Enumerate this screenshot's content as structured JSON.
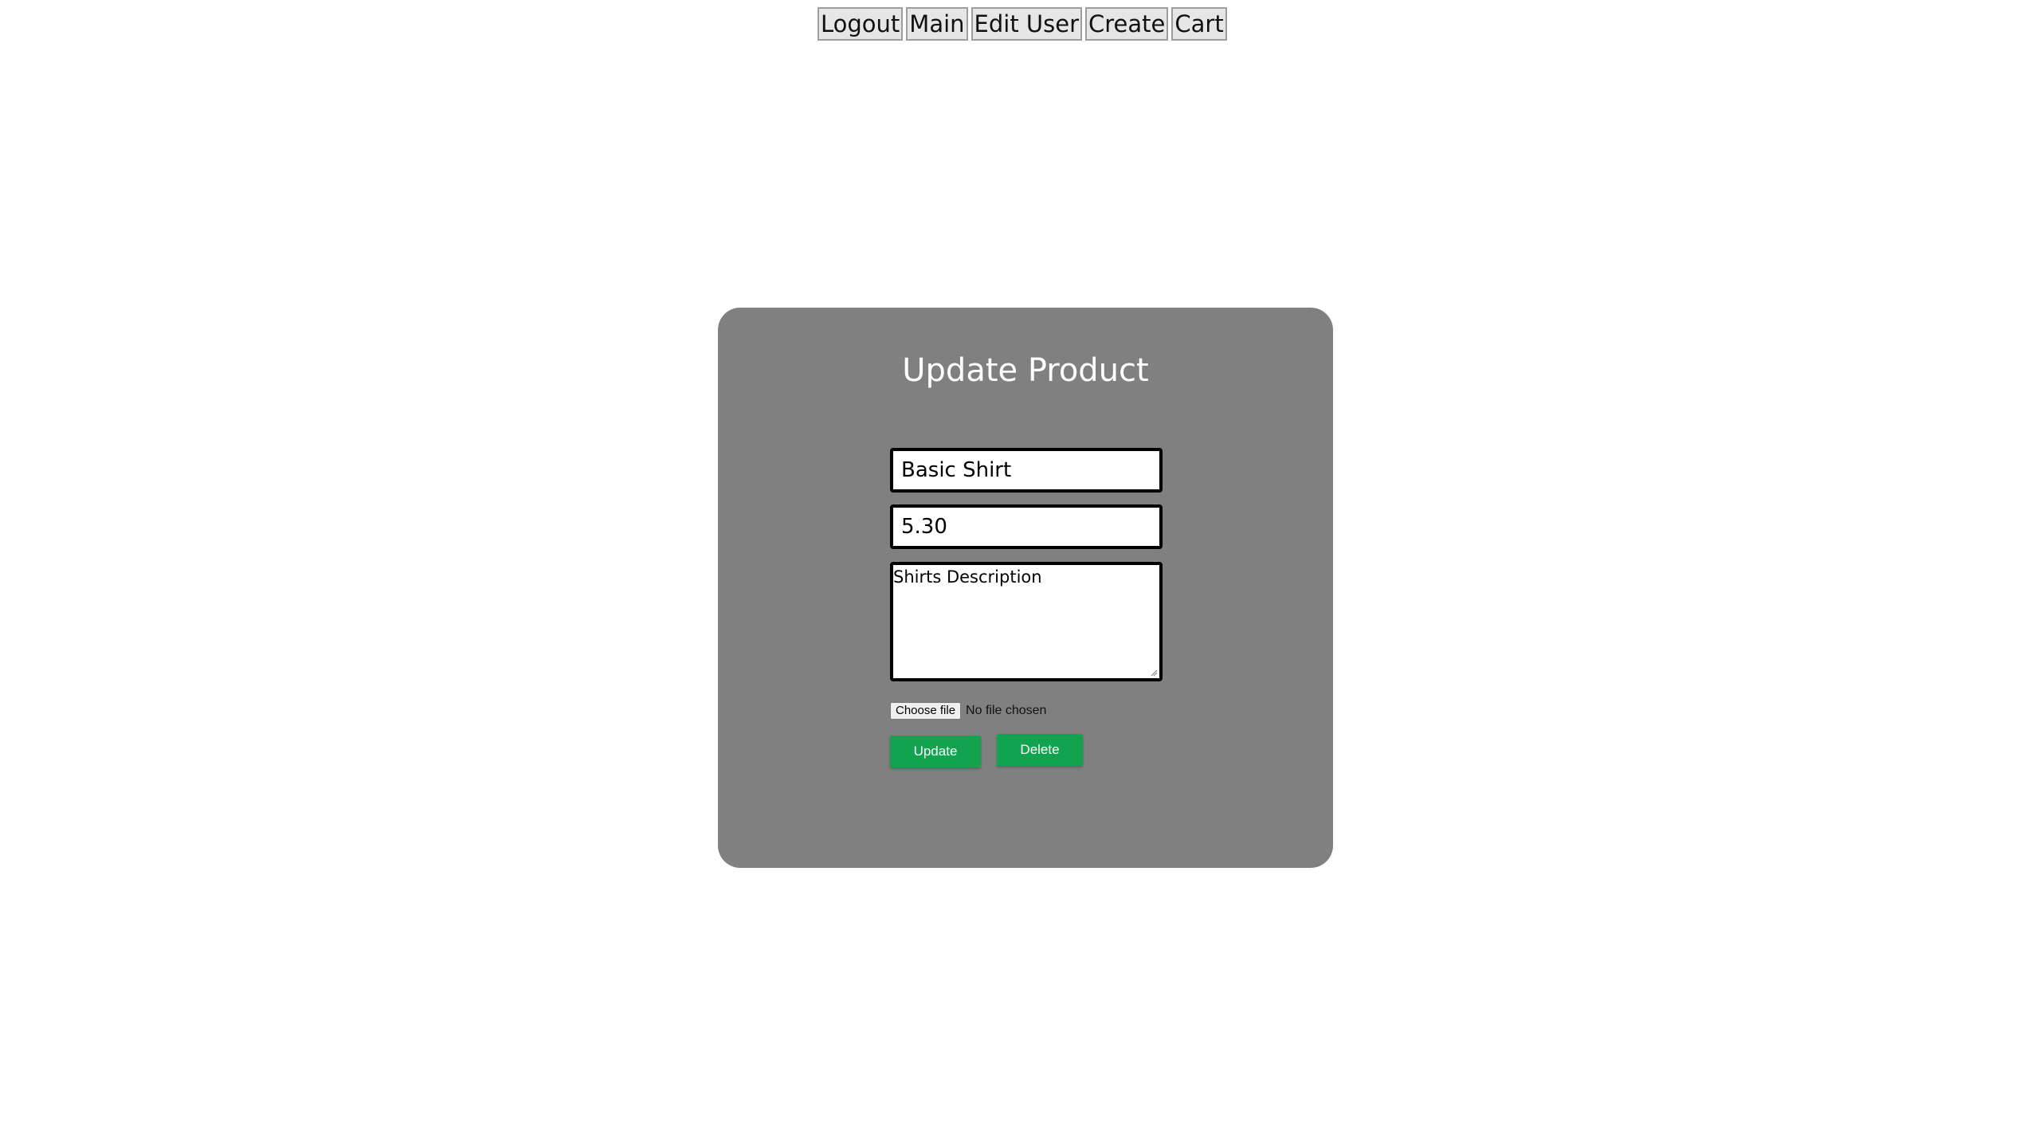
{
  "nav": {
    "logout": "Logout",
    "main": "Main",
    "edit_user": "Edit User",
    "create": "Create",
    "cart": "Cart"
  },
  "form": {
    "title": "Update Product",
    "name_value": "Basic Shirt",
    "price_value": "5.30",
    "description_value": "Shirts Description",
    "file_button_label": "Choose file",
    "file_status": "No file chosen",
    "update_label": "Update",
    "delete_label": "Delete"
  },
  "colors": {
    "panel_background": "#808080",
    "action_button": "#12a34f",
    "nav_button": "#e6e6e6"
  }
}
